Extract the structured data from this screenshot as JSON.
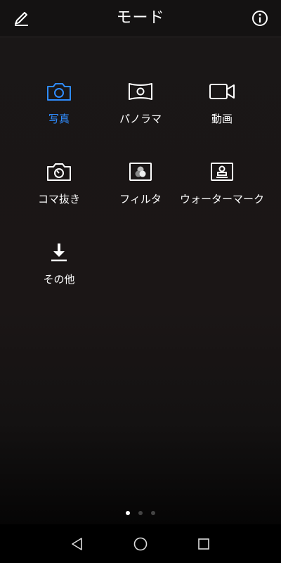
{
  "header": {
    "title": "モード"
  },
  "modes": [
    {
      "label": "写真",
      "icon": "camera-icon",
      "active": true
    },
    {
      "label": "パノラマ",
      "icon": "panorama-icon",
      "active": false
    },
    {
      "label": "動画",
      "icon": "video-camera-icon",
      "active": false
    },
    {
      "label": "コマ抜き",
      "icon": "timelapse-icon",
      "active": false
    },
    {
      "label": "フィルタ",
      "icon": "filter-icon",
      "active": false
    },
    {
      "label": "ウォーターマーク",
      "icon": "watermark-icon",
      "active": false
    },
    {
      "label": "その他",
      "icon": "download-icon",
      "active": false
    }
  ],
  "pager": {
    "total_pages": 3,
    "current_page": 1
  },
  "colors": {
    "accent": "#2f8cff",
    "background": "#1a1717",
    "nav": "#000000"
  }
}
